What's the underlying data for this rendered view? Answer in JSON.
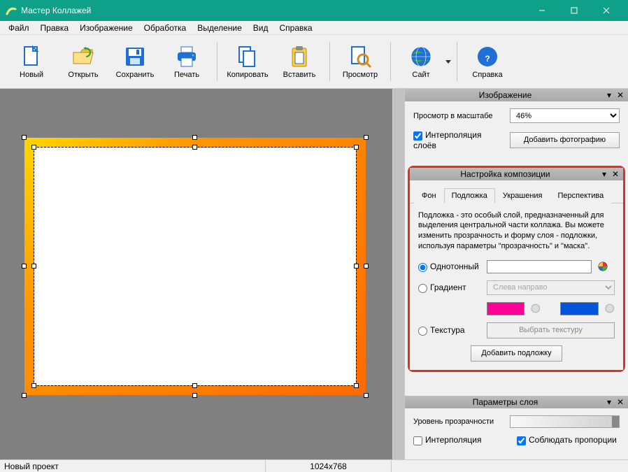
{
  "window": {
    "title": "Мастер Коллажей"
  },
  "menu": {
    "items": [
      "Файл",
      "Правка",
      "Изображение",
      "Обработка",
      "Выделение",
      "Вид",
      "Справка"
    ]
  },
  "toolbar": {
    "new": "Новый",
    "open": "Открыть",
    "save": "Сохранить",
    "print": "Печать",
    "copy": "Копировать",
    "paste": "Вставить",
    "preview": "Просмотр",
    "site": "Сайт",
    "help": "Справка"
  },
  "panels": {
    "image": {
      "title": "Изображение",
      "zoom_label": "Просмотр в масштабе",
      "zoom_value": "46%",
      "interp_layers": "Интерполяция слоёв",
      "add_photo": "Добавить фотографию"
    },
    "composition": {
      "title": "Настройка композиции",
      "tabs": {
        "bg": "Фон",
        "underlay": "Подложка",
        "decor": "Украшения",
        "persp": "Перспектива"
      },
      "desc": "Подложка - это особый слой,  предназначенный для выделения центральной части коллажа.  Вы можете изменить прозрачность и  форму слоя - подложки, используя параметры \"прозрачность\" и \"маска\".",
      "solid": "Однотонный",
      "gradient": "Градиент",
      "gradient_dir": "Слева направо",
      "texture": "Текстура",
      "choose_texture": "Выбрать текстуру",
      "add_underlay": "Добавить подложку",
      "grad_color1": "#ff0099",
      "grad_color2": "#0055dd"
    },
    "layer": {
      "title": "Параметры слоя",
      "opacity": "Уровень прозрачности",
      "interp": "Интерполяция",
      "keep_ratio": "Соблюдать пропорции"
    }
  },
  "status": {
    "project": "Новый проект",
    "dims": "1024x768"
  }
}
